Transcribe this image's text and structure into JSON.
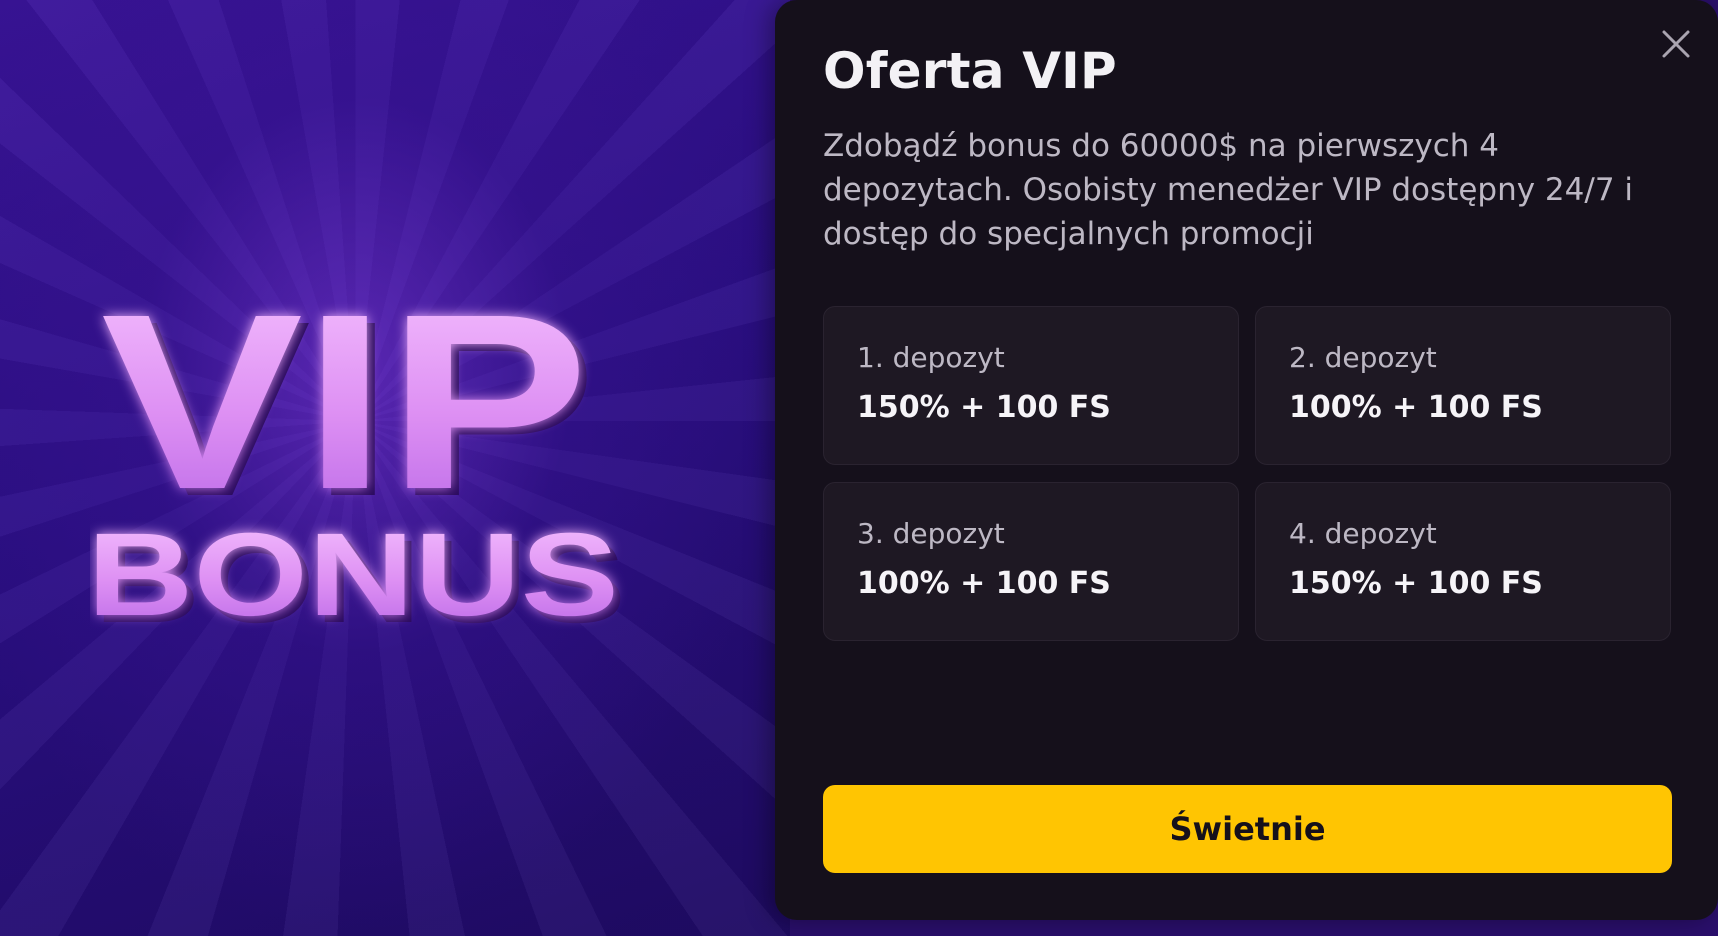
{
  "promo": {
    "line1": "VIP",
    "line2": "BONUS"
  },
  "dialog": {
    "title": "Oferta VIP",
    "description": "Zdobądź bonus do 60000$ na pierwszych 4 depozytach. Osobisty menedżer VIP dostępny 24/7 i dostęp do specjalnych promocji",
    "deposits": [
      {
        "label": "1. depozyt",
        "value": "150% + 100 FS"
      },
      {
        "label": "2. depozyt",
        "value": "100% + 100 FS"
      },
      {
        "label": "3. depozyt",
        "value": "100% + 100 FS"
      },
      {
        "label": "4. depozyt",
        "value": "150% + 100 FS"
      }
    ],
    "confirm_label": "Świetnie",
    "close_icon": "close-icon"
  },
  "colors": {
    "accent": "#ffc502",
    "dialog_bg": "#15101b",
    "card_bg": "#1e1823",
    "promo_bg": "#2b0f86",
    "promo_text": "#e39af5"
  }
}
